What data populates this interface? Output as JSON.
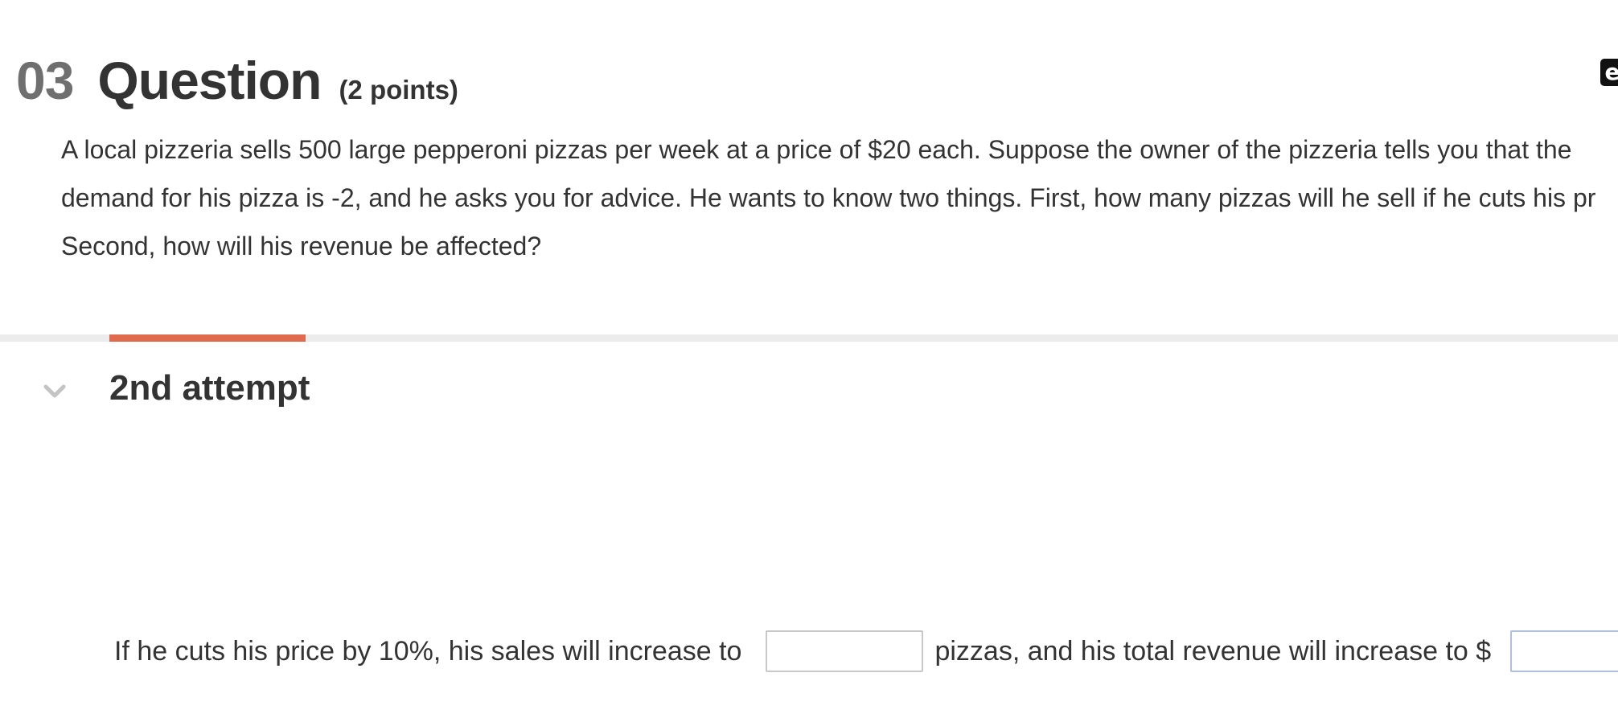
{
  "question": {
    "number": "03",
    "title": "Question",
    "points": "(2 points)",
    "ebook_icon_glyph": "e",
    "text_lines": [
      "A local pizzeria sells 500 large pepperoni pizzas per week at a price of $20 each. Suppose the owner of the pizzeria tells you that the",
      "demand for his pizza is -2, and he asks you for advice. He wants to know two things. First, how many pizzas will he sell if he cuts his pr",
      "Second, how will his revenue be affected?"
    ]
  },
  "attempt": {
    "label": "2nd attempt",
    "accent_color": "#e06a4e"
  },
  "answer": {
    "prefix": "If he cuts his price by 10%, his sales will increase to",
    "middle": "pizzas, and his total revenue will increase to $",
    "sales_value": "",
    "revenue_value": ""
  },
  "icons": {
    "ebook": "ebook-icon",
    "chevron": "chevron-down-icon"
  }
}
